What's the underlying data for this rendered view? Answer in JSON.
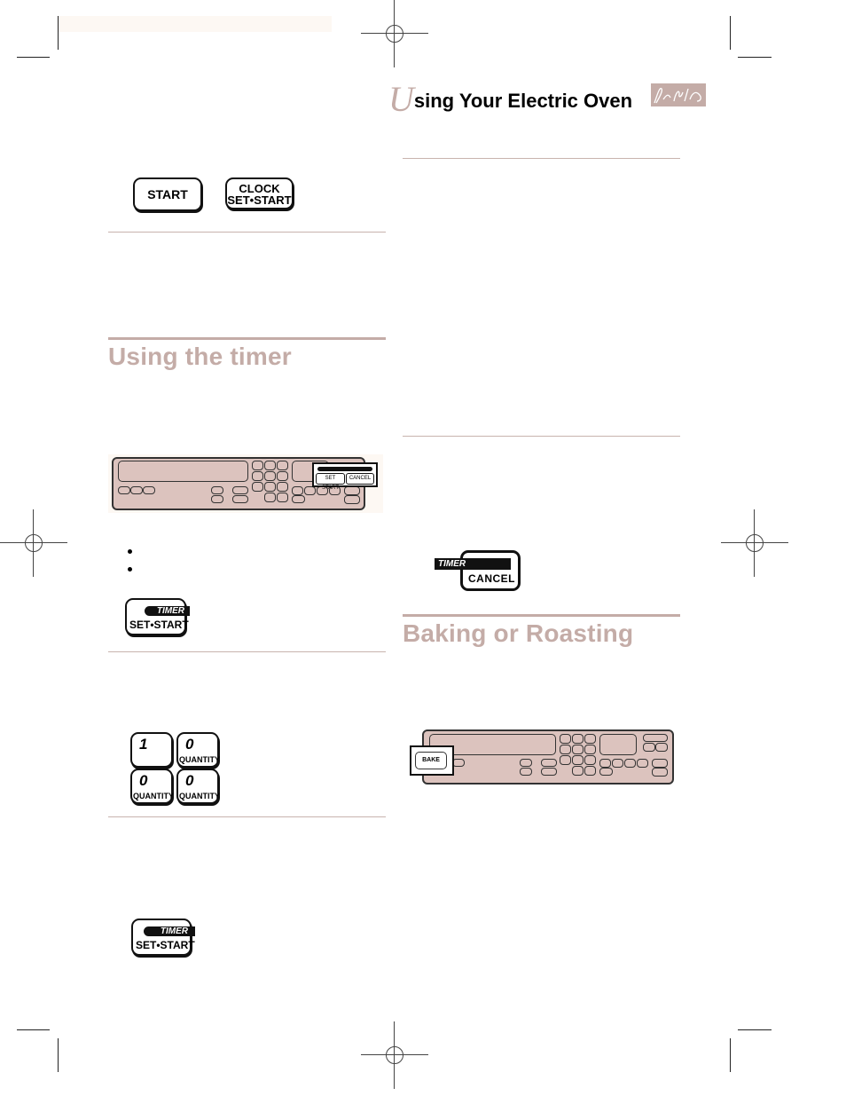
{
  "header": {
    "title_initial": "U",
    "title_rest": "sing Your Electric Oven",
    "signature_icon": "signature-logo"
  },
  "keys": {
    "start": "START",
    "clock_top": "CLOCK",
    "clock_bottom": "SET•START",
    "timer_label": "TIMER",
    "set_start": "SET•START",
    "cancel": "CANCEL"
  },
  "sections": {
    "timer": {
      "title": "Using the timer"
    },
    "baking": {
      "title": "Baking or Roasting"
    }
  },
  "timer_panel": {
    "callout_timer": "TIMER",
    "callout_set_start": "SET START",
    "callout_cancel": "CANCEL"
  },
  "number_keys": [
    {
      "digit": "1",
      "sub": ""
    },
    {
      "digit": "0",
      "sub": "QUANTITY"
    },
    {
      "digit": "0",
      "sub": "QUANTITY"
    },
    {
      "digit": "0",
      "sub": "QUANTITY"
    }
  ],
  "bake_panel": {
    "callout_bake": "BAKE"
  },
  "colors": {
    "accent": "#c4aca7",
    "panel_fill": "#dcc3be"
  }
}
